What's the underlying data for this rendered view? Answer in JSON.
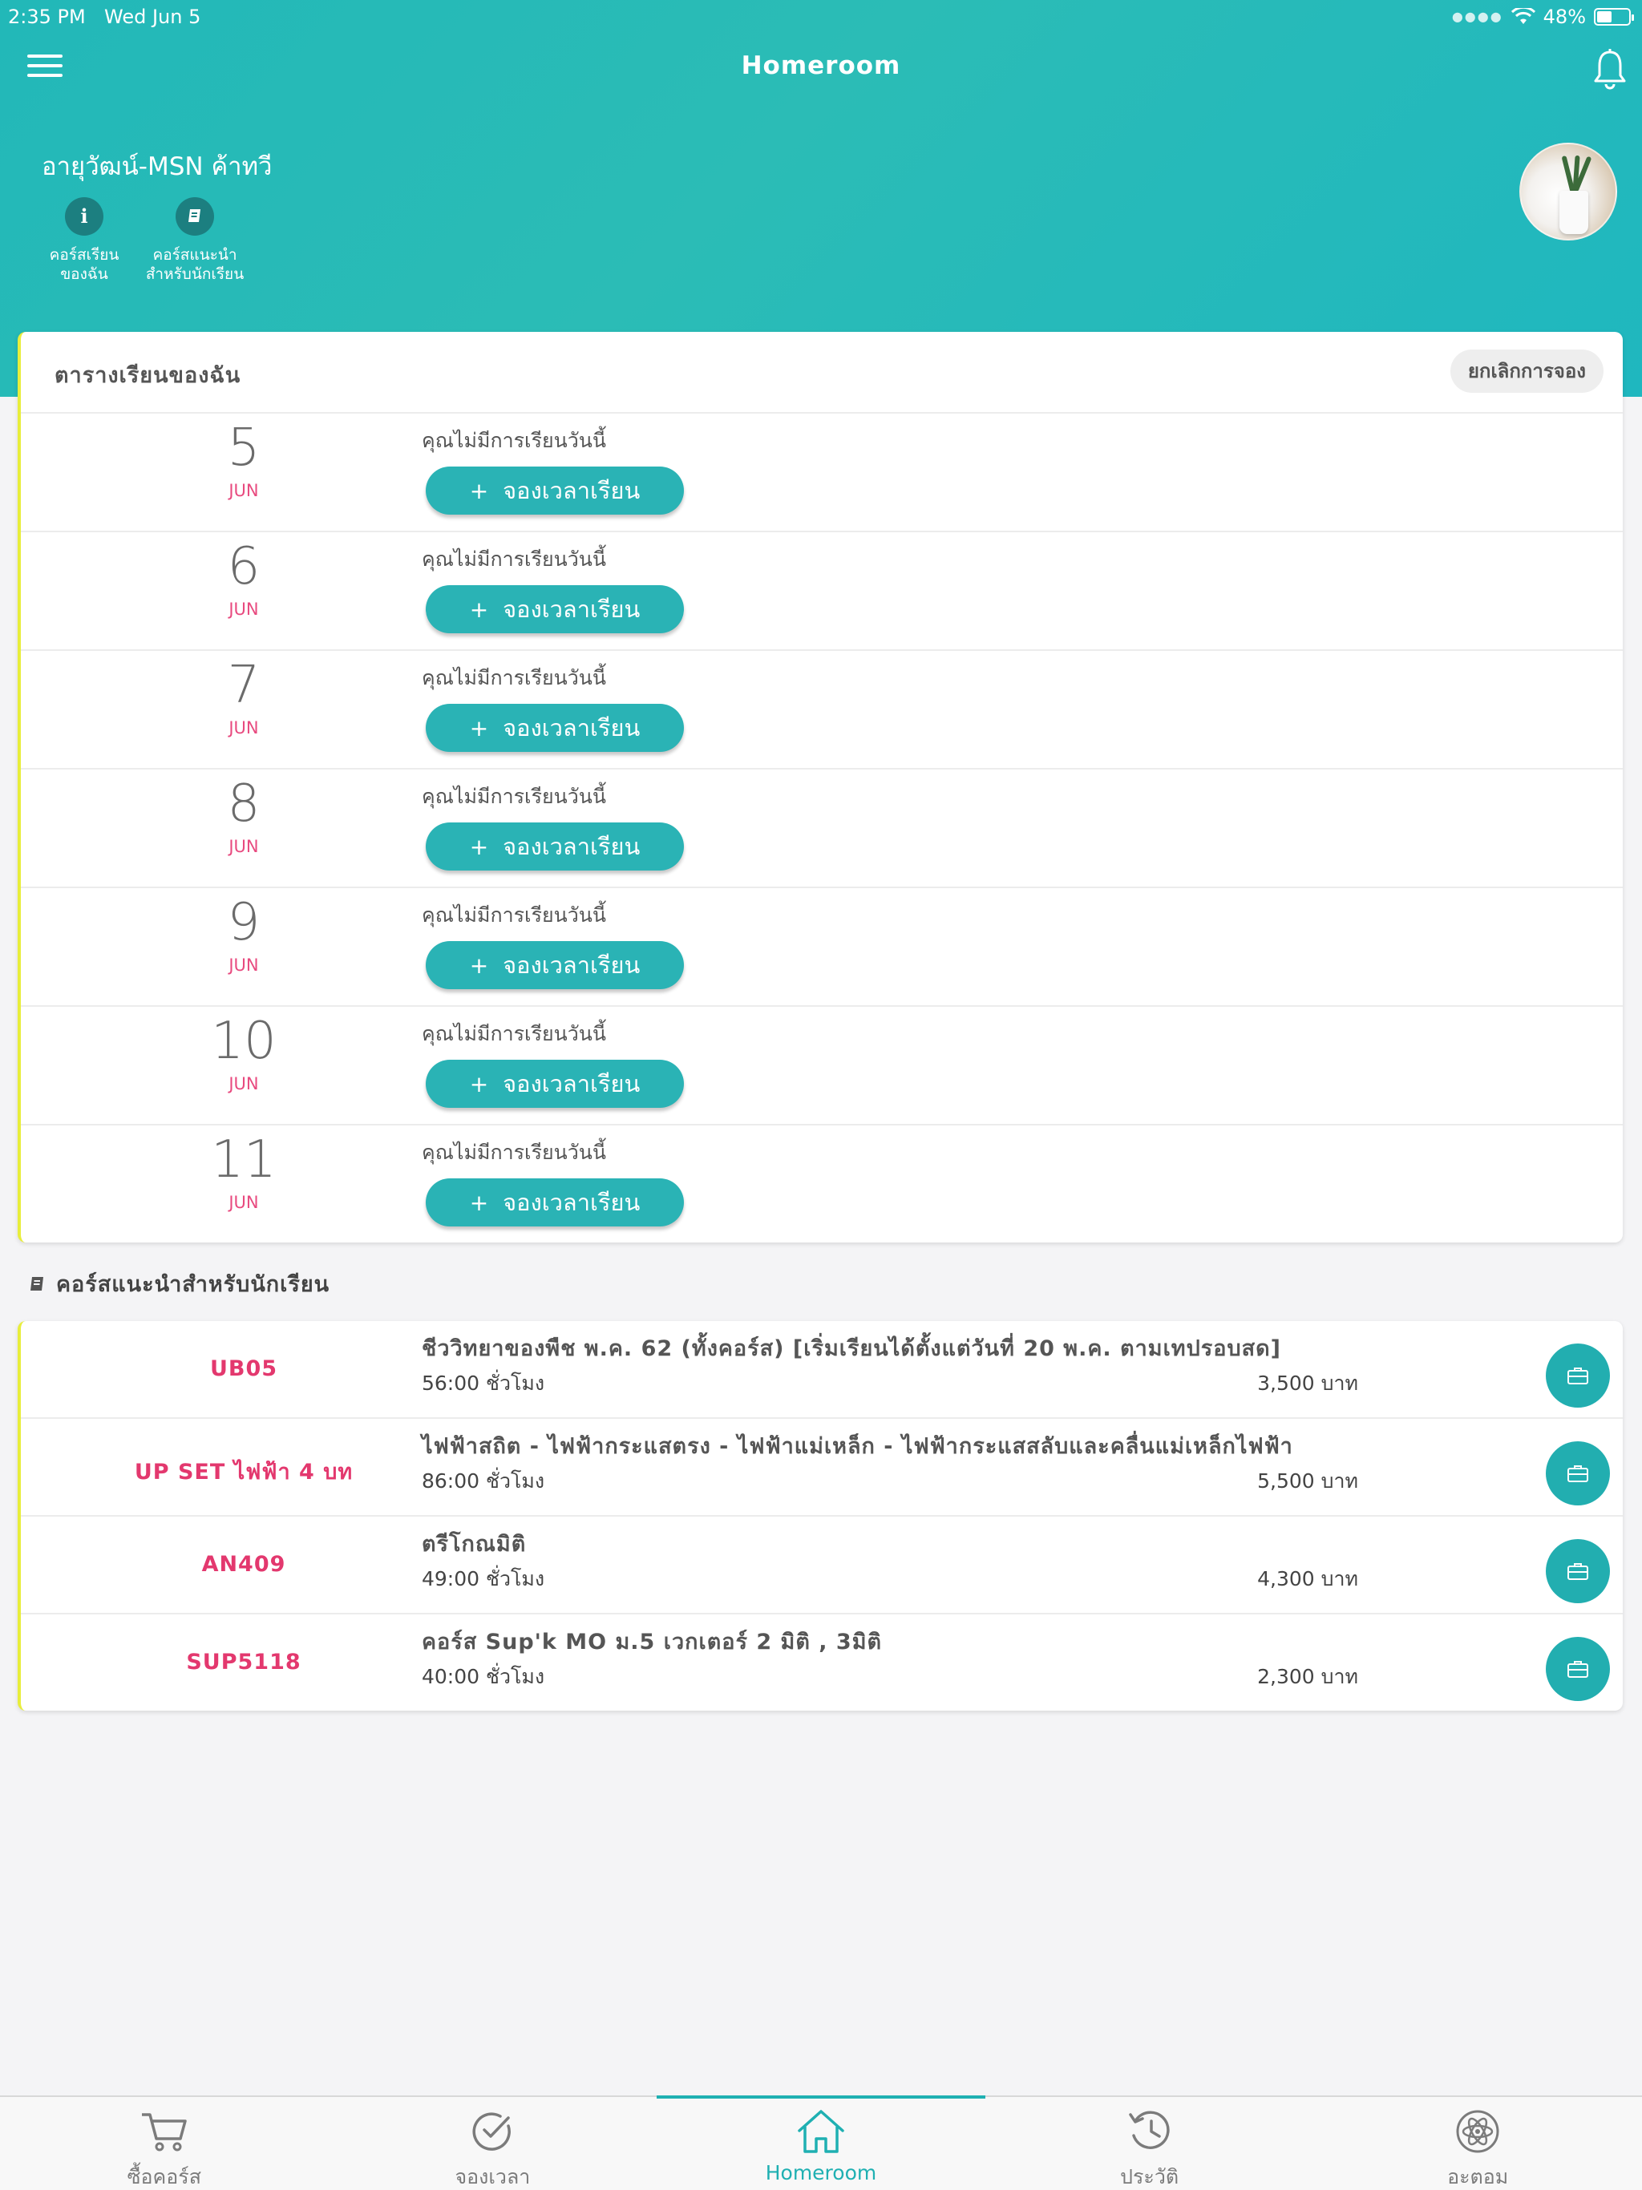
{
  "status_bar": {
    "time": "2:35 PM",
    "date": "Wed Jun 5",
    "battery": "48%",
    "battery_level": 0.48
  },
  "nav": {
    "title": "Homeroom"
  },
  "user": {
    "name": "อายุวัฒน์-MSN ค้าทวี",
    "quick_links": [
      {
        "icon": "info-icon",
        "label_line1": "คอร์สเรียน",
        "label_line2": "ของฉัน"
      },
      {
        "icon": "book-icon",
        "label_line1": "คอร์สแนะนำ",
        "label_line2": "สำหรับนักเรียน"
      }
    ]
  },
  "schedule": {
    "title": "ตารางเรียนของฉัน",
    "cancel_label": "ยกเลิกการจอง",
    "no_class_text": "คุณไม่มีการเรียนวันนี้",
    "book_label": "จองเวลาเรียน",
    "days": [
      {
        "day": "5",
        "month": "JUN"
      },
      {
        "day": "6",
        "month": "JUN"
      },
      {
        "day": "7",
        "month": "JUN"
      },
      {
        "day": "8",
        "month": "JUN"
      },
      {
        "day": "9",
        "month": "JUN"
      },
      {
        "day": "10",
        "month": "JUN"
      },
      {
        "day": "11",
        "month": "JUN"
      }
    ]
  },
  "recommended": {
    "title": "คอร์สแนะนำสำหรับนักเรียน",
    "courses": [
      {
        "code": "UB05",
        "name": "ชีววิทยาของพืช พ.ค. 62 (ทั้งคอร์ส) [เริ่มเรียนได้ตั้งแต่วันที่ 20 พ.ค. ตามเทปรอบสด]",
        "hours": "56:00 ชั่วโมง",
        "price": "3,500 บาท"
      },
      {
        "code": "UP SET ไฟฟ้า 4 บท",
        "name": "ไฟฟ้าสถิต - ไฟฟ้ากระแสตรง - ไฟฟ้าแม่เหล็ก - ไฟฟ้ากระแสสลับและคลื่นแม่เหล็กไฟฟ้า",
        "hours": "86:00 ชั่วโมง",
        "price": "5,500 บาท"
      },
      {
        "code": "AN409",
        "name": "ตรีโกณมิติ",
        "hours": "49:00 ชั่วโมง",
        "price": "4,300 บาท"
      },
      {
        "code": "SUP5118",
        "name": "คอร์ส Sup'k MO ม.5 เวกเตอร์ 2 มิติ , 3มิติ",
        "hours": "40:00 ชั่วโมง",
        "price": "2,300 บาท"
      }
    ]
  },
  "tabs": [
    {
      "label": "ซื้อคอร์ส",
      "icon": "cart-icon"
    },
    {
      "label": "จองเวลา",
      "icon": "check-circle-icon"
    },
    {
      "label": "Homeroom",
      "icon": "home-icon",
      "active": true
    },
    {
      "label": "ประวัติ",
      "icon": "history-icon"
    },
    {
      "label": "อะตอม",
      "icon": "atom-icon"
    }
  ],
  "colors": {
    "accent": "#22b5b5",
    "code_pink": "#e3386e",
    "card_edge": "#e8ee3c"
  }
}
